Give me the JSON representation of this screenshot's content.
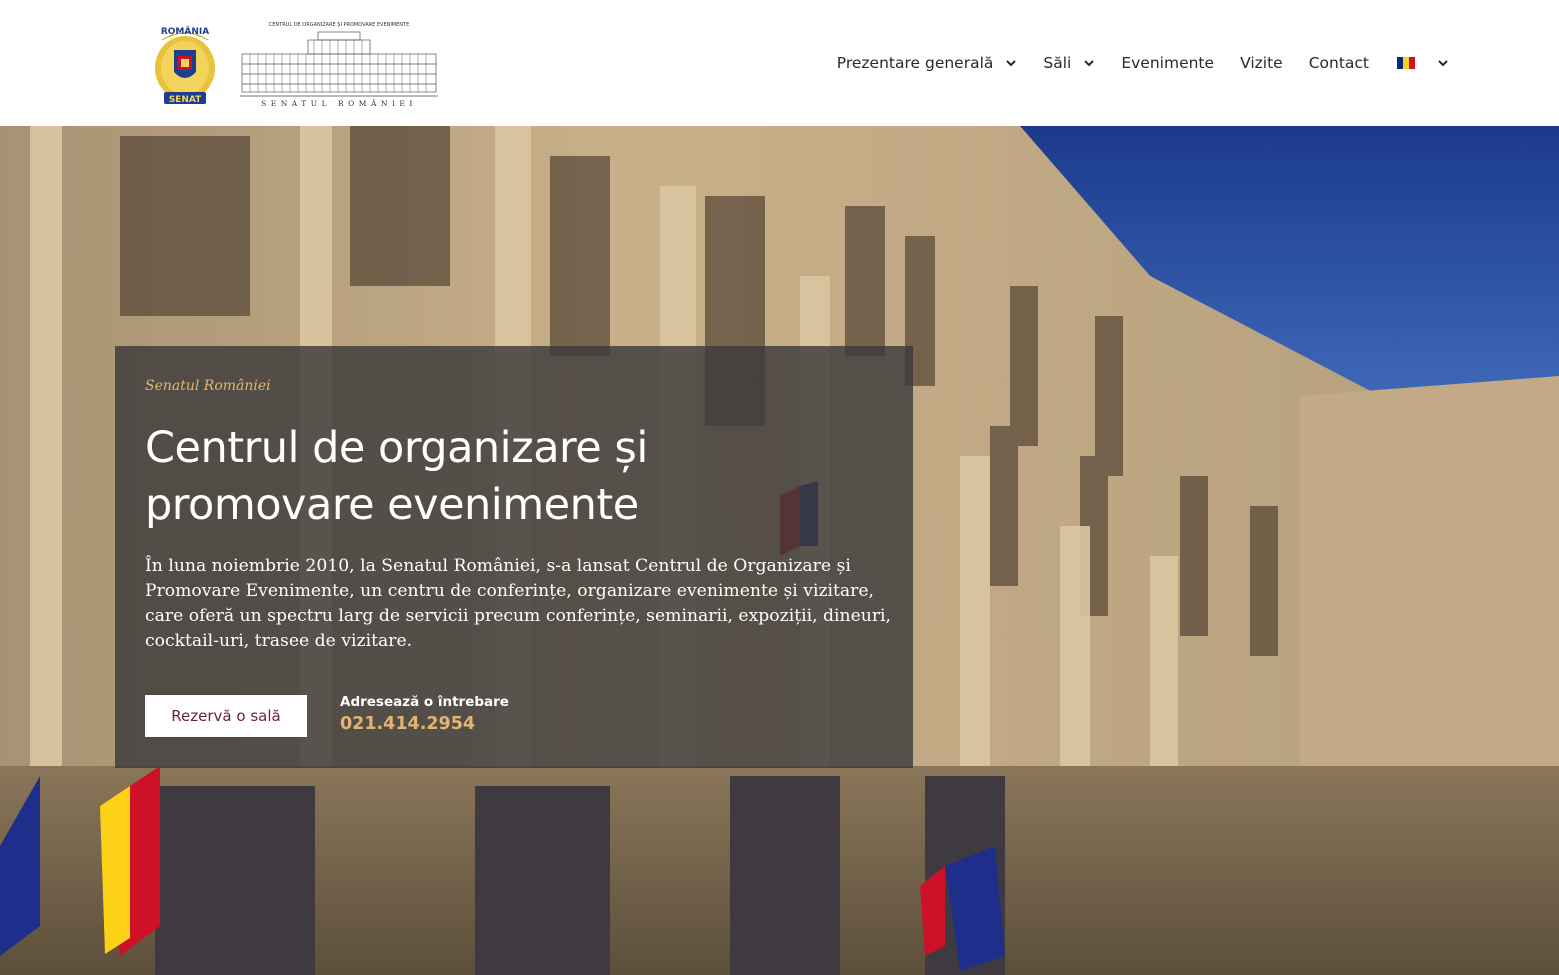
{
  "header": {
    "crest_text_top": "ROMÂNIA",
    "crest_text_bottom": "SENAT",
    "logo_caption_top": "CENTRUL DE ORGANIZARE ȘI PROMOVARE EVENIMENTE",
    "logo_caption_bottom": "SENATUL  ROMÂNIEI",
    "nav": [
      {
        "label": "Prezentare generală",
        "has_dropdown": true
      },
      {
        "label": "Săli",
        "has_dropdown": true
      },
      {
        "label": "Evenimente",
        "has_dropdown": false
      },
      {
        "label": "Vizite",
        "has_dropdown": false
      },
      {
        "label": "Contact",
        "has_dropdown": false
      }
    ],
    "language_flag": "flag-ro-icon",
    "flag_colors": [
      "#002B7F",
      "#FCD116",
      "#CE1126"
    ]
  },
  "hero": {
    "kicker": "Senatul României",
    "title": "Centrul de organizare și promovare evenimente",
    "description": "În luna noiembrie 2010, la Senatul României, s-a lansat Centrul de Organizare și Promovare Evenimente, un centru de conferințe, organizare evenimente și vizitare, care oferă un spectru larg de servicii precum conferințe, seminarii, expoziții, dineuri, cocktail-uri, trasee de vizitare.",
    "cta_label": "Rezervă o sală",
    "ask_label": "Adresează o întrebare",
    "phone": "021.414.2954"
  },
  "colors": {
    "accent": "#E2B574",
    "cta_text": "#6A2530",
    "panel": "#3C3A3A"
  }
}
